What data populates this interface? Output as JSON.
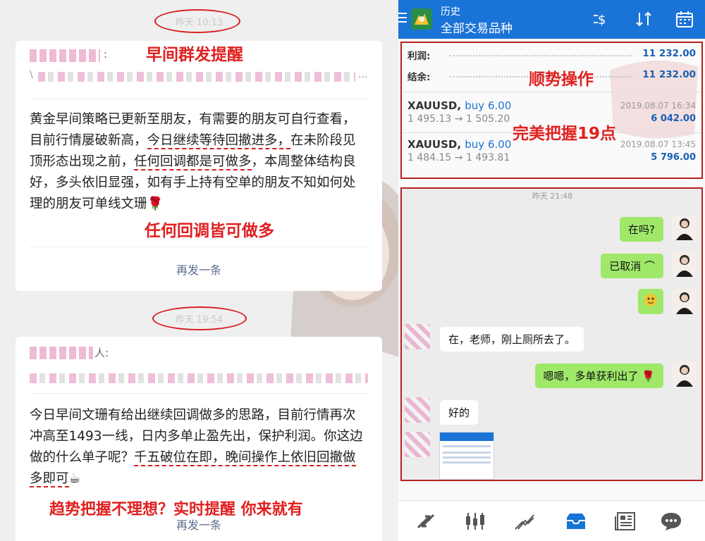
{
  "left": {
    "timestamp_1": "昨天 10:13",
    "timestamp_2": "昨天 19:54",
    "card1": {
      "title_suffix": ":",
      "line_prefix": "\\",
      "line_suffix": "...",
      "body_a": "黄金早间策略已更新至朋友，有需要的朋友可自行查看，目前行情屡破新高，",
      "body_u1": "今日继续等待回撤进多，",
      "body_b": "在未阶段见顶形态出现之前，",
      "body_u2": "任何回调都是可做多",
      "body_c": "，本周整体结构良好，多头依旧显强，如有手上持有空单的朋友不知如何处理的朋友可单线文珊",
      "emoji": "🌹",
      "resend": "再发一条"
    },
    "card2": {
      "title_suffix": "人:",
      "body_a": "今日早间文珊有给出继续回调做多的思路，目前行情再次冲高至1493一线，日内多单止盈先出，保护利润。你这边做的什么单子呢？",
      "body_u1": "千五破位在即，晚间操作上依旧回撤做多即可",
      "emoji": "☕",
      "resend": "再发一条"
    },
    "overlay_1": "早间群发提醒",
    "overlay_2": "任何回调皆可做多",
    "overlay_3": "趋势把握不理想？实时提醒 你来就有"
  },
  "right": {
    "topbar": {
      "title_small": "历史",
      "title_large": "全部交易品种"
    },
    "account": {
      "profit_label": "利润:",
      "profit_value": "11 232.00",
      "balance_label": "结余:",
      "balance_value": "11 232.00"
    },
    "trades": [
      {
        "symbol": "XAUUSD,",
        "side": "buy 6.00",
        "prices": "1 495.13 → 1 505.20",
        "date": "2019.08.07 16:34",
        "pnl": "6 042.00"
      },
      {
        "symbol": "XAUUSD,",
        "side": "buy 6.00",
        "prices": "1 484.15 → 1 493.81",
        "date": "2019.08.07 13:45",
        "pnl": "5 796.00"
      }
    ],
    "overlay_1": "顺势操作",
    "overlay_2": "完美把握19点",
    "chat": {
      "timestamp": "昨天 21:48",
      "m1": "在吗?",
      "m2": "已取消",
      "m3": "在，老师，刚上厕所去了。",
      "m4": "嗯嗯，多单获利出了",
      "m4_emoji": "🌹",
      "m5": "好的"
    }
  },
  "colors": {
    "accent_blue": "#1a73d6",
    "profit_blue": "#1a5fb4",
    "overlay_red": "#e02020",
    "bubble_green": "#9fe86a"
  }
}
